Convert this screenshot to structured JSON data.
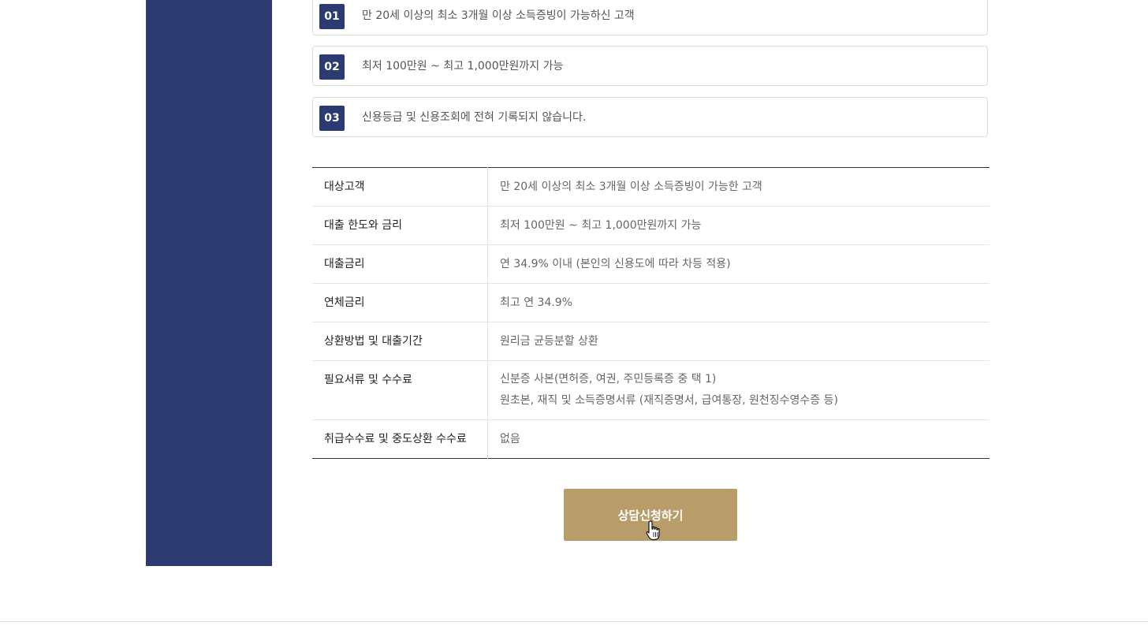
{
  "features": [
    {
      "num": "01",
      "text": "만 20세 이상의 최소 3개월 이상 소득증빙이 가능하신 고객"
    },
    {
      "num": "02",
      "text": "최저 100만원 ~ 최고 1,000만원까지 가능"
    },
    {
      "num": "03",
      "text": "신용등급 및 신용조회에 전혀 기록되지 않습니다."
    }
  ],
  "table": {
    "rows": [
      {
        "key": "대상고객",
        "value": "만 20세 이상의 최소 3개월 이상 소득증빙이 가능한 고객"
      },
      {
        "key": "대출 한도와 금리",
        "value": "최저 100만원 ~ 최고 1,000만원까지 가능"
      },
      {
        "key": "대출금리",
        "value": "연 34.9% 이내 (본인의 신용도에 따라 차등 적용)"
      },
      {
        "key": "연체금리",
        "value": "최고 연 34.9%"
      },
      {
        "key": "상환방법 및 대출기간",
        "value": "원리금 균등분할 상환"
      },
      {
        "key": "필요서류 및 수수료",
        "value": "신분증 사본(면허증, 여권, 주민등록증 중 택 1)",
        "value2": "원초본, 재직 및 소득증명서류 (재직증명서, 급여통장, 원천징수영수증 등)"
      },
      {
        "key": "취급수수료 및 중도상환 수수료",
        "value": "없음"
      }
    ]
  },
  "cta": {
    "label": "상담신청하기"
  },
  "colors": {
    "navy": "#2c3a72",
    "gold": "#b89d6b"
  }
}
